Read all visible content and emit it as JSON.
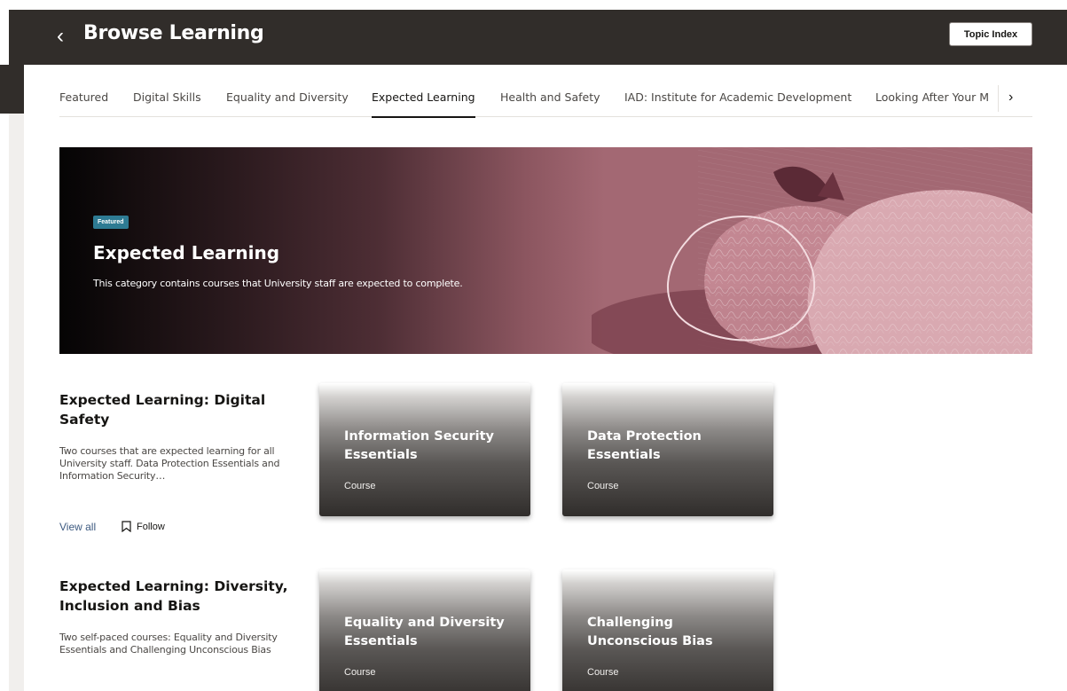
{
  "header": {
    "title": "Browse Learning",
    "back_glyph": "‹",
    "topic_index_label": "Topic Index"
  },
  "tabs": [
    {
      "label": "Featured",
      "active": false
    },
    {
      "label": "Digital Skills",
      "active": false
    },
    {
      "label": "Equality and Diversity",
      "active": false
    },
    {
      "label": "Expected Learning",
      "active": true
    },
    {
      "label": "Health and Safety",
      "active": false
    },
    {
      "label": "IAD: Institute for Academic Development",
      "active": false
    },
    {
      "label": "Looking After Your M",
      "active": false
    }
  ],
  "tab_next_glyph": "›",
  "hero": {
    "badge": "Featured",
    "title": "Expected Learning",
    "description": "This category contains courses that University staff are expected to complete."
  },
  "sections": [
    {
      "title": "Expected Learning: Digital Safety",
      "description": "Two courses that are expected learning for all University staff. Data Protection Essentials and Information Security…",
      "view_all": "View all",
      "follow": "Follow",
      "cards": [
        {
          "title": "Information Security Essentials",
          "type": "Course"
        },
        {
          "title": "Data Protection Essentials",
          "type": "Course"
        }
      ]
    },
    {
      "title": "Expected Learning: Diversity, Inclusion and Bias",
      "description": "Two self-paced courses: Equality and Diversity Essentials and Challenging Unconscious Bias",
      "cards": [
        {
          "title": "Equality and Diversity Essentials",
          "type": "Course"
        },
        {
          "title": "Challenging Unconscious Bias",
          "type": "Course"
        }
      ]
    }
  ],
  "colors": {
    "header_bg": "#312d2a",
    "hero_accent": "#a36873",
    "badge": "#2e7b93",
    "link": "#3d5a80"
  },
  "icons": [
    "chevron-left-icon",
    "chevron-right-icon",
    "bookmark-icon"
  ]
}
